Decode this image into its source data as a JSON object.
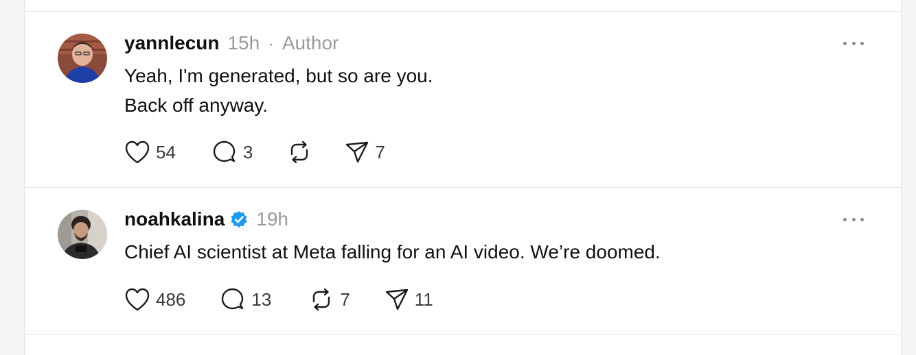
{
  "posts": [
    {
      "username": "yannlecun",
      "time": "15h",
      "separator": "·",
      "badge": "Author",
      "verified": false,
      "lines": [
        "Yeah, I'm generated, but so are you.",
        "Back off anyway."
      ],
      "likes": "54",
      "replies": "3",
      "reposts": "",
      "shares": "7"
    },
    {
      "username": "noahkalina",
      "time": "19h",
      "verified": true,
      "lines": [
        "Chief AI scientist at Meta falling for an AI video. We’re doomed."
      ],
      "likes": "486",
      "replies": "13",
      "reposts": "7",
      "shares": "11"
    }
  ],
  "colors": {
    "verified_badge": "#1d9bf0",
    "meta_text": "#9a9a9a",
    "divider": "#e3e3e3"
  },
  "icons": [
    "heart-icon",
    "comment-icon",
    "repost-icon",
    "share-icon",
    "more-icon",
    "verified-icon"
  ]
}
